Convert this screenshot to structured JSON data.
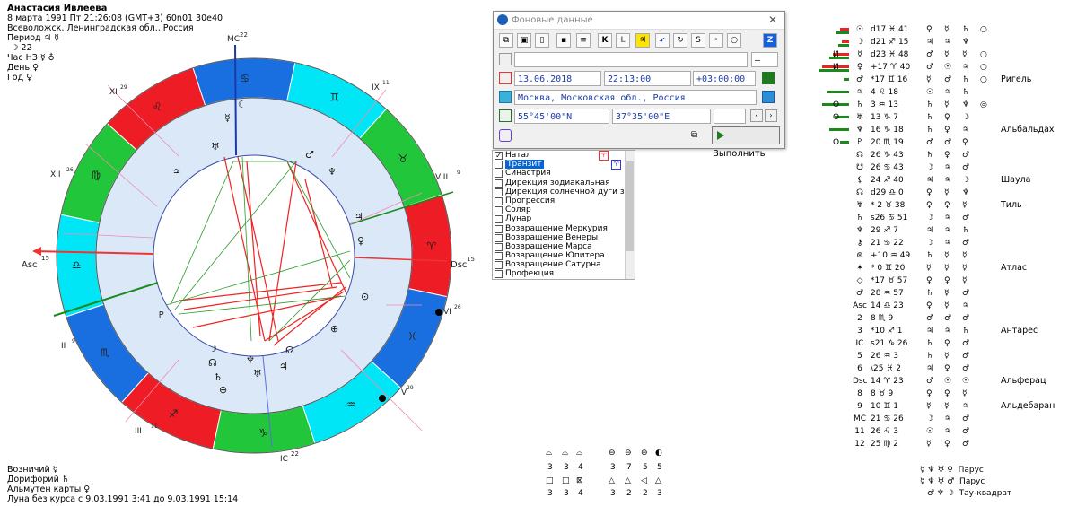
{
  "info": {
    "name": "Анастасия Ивлеева",
    "datetime": "8 марта 1991  Пт  21:26:08 (GMT+3) 60n01  30e40",
    "place": "Всеволожск, Ленинградская обл., Россия",
    "period": "Период ♃ ☿",
    "line_moon": "☽ 22",
    "hour_hz": "Час НЗ ☿ ♁",
    "day": "День ♀",
    "year": "Год ♀"
  },
  "bottom": {
    "voznichiy": "Возничий ☿",
    "doriforiy": "Дорифорий ♄",
    "almuten": "Альмутен карты ♀",
    "moon_void": "Луна без курса с 9.03.1991  3:41 до 9.03.1991 15:14"
  },
  "wheel": {
    "asc": "Asc",
    "asc_deg": "15",
    "dsc": "Dsc",
    "dsc_deg": "15",
    "mc": "MC",
    "mc_deg": "22",
    "ic": "IC",
    "ic_deg": "22",
    "houses": [
      "XII",
      "XI",
      "IX",
      "VIII",
      "VI",
      "V",
      "III",
      "II"
    ],
    "house_degs": [
      "26",
      "29",
      "11",
      "9",
      "26",
      "29",
      "11",
      "9"
    ],
    "signs": [
      "♈",
      "♉",
      "♊",
      "♋",
      "♌",
      "♍",
      "♎",
      "♏",
      "♐",
      "♑",
      "♒",
      "♓"
    ],
    "colors": {
      "fire": "#ee1c24",
      "earth": "#22c63b",
      "air": "#00e6f6",
      "water": "#1a6fe0",
      "inner": "#dbe8f7"
    }
  },
  "dialog": {
    "title": "Фоновые данные",
    "date": "13.06.2018",
    "time": "22:13:00",
    "tz": "+03:00:00",
    "city": "Москва, Московская обл., Россия",
    "lat": "55°45'00\"N",
    "lon": "37°35'00\"E",
    "run": "Выполнить",
    "sign_select": "–",
    "toolbar": [
      "K",
      "L",
      "Z"
    ]
  },
  "chartlist": [
    {
      "label": "Натал",
      "checked": true
    },
    {
      "label": "Транзит",
      "checked": false,
      "selected": true
    },
    {
      "label": "Синастрия",
      "checked": false
    },
    {
      "label": "Дирекция зодиакальная",
      "checked": false
    },
    {
      "label": "Дирекция солнечной дуги зодиак",
      "checked": false
    },
    {
      "label": "Прогрессия",
      "checked": false
    },
    {
      "label": "Соляр",
      "checked": false
    },
    {
      "label": "Лунар",
      "checked": false
    },
    {
      "label": "Возвращение Меркурия",
      "checked": false
    },
    {
      "label": "Возвращение Венеры",
      "checked": false
    },
    {
      "label": "Возвращение Марса",
      "checked": false
    },
    {
      "label": "Возвращение Юпитера",
      "checked": false
    },
    {
      "label": "Возвращение Сатурна",
      "checked": false
    },
    {
      "label": "Профекция",
      "checked": false
    }
  ],
  "planets": [
    {
      "sym": "☉",
      "pos": "d17 ♓ 41",
      "c1": "♀",
      "c2": "☿",
      "c3": "♄",
      "c4": "○",
      "bar": "red"
    },
    {
      "sym": "☽",
      "pos": "d21 ♐ 15",
      "c1": "♃",
      "c2": "♃",
      "c3": "♆",
      "c4": "",
      "bar": "red"
    },
    {
      "sym": "☿",
      "pos": "d23 ♓ 48",
      "c1": "♂",
      "c2": "☿",
      "c3": "☿",
      "c4": "○",
      "bar": "red",
      "mark": "И"
    },
    {
      "sym": "♀",
      "pos": "+17 ♈ 40",
      "c1": "♂",
      "c2": "☉",
      "c3": "♃",
      "c4": "○",
      "bar": "red",
      "mark": "И"
    },
    {
      "sym": "♂",
      "pos": "*17 ♊ 16",
      "c1": "☿",
      "c2": "♂",
      "c3": "♄",
      "c4": "○",
      "bar": "green"
    },
    {
      "sym": "♃",
      "pos": "4 ♌ 18",
      "c1": "☉",
      "c2": "♃",
      "c3": "♄",
      "c4": "",
      "bar": "green"
    },
    {
      "sym": "♄",
      "pos": "3 ♒ 13",
      "c1": "♄",
      "c2": "☿",
      "c3": "♆",
      "c4": "◎",
      "bar": "green",
      "mark": "О"
    },
    {
      "sym": "♅",
      "pos": "13 ♑ 7",
      "c1": "♄",
      "c2": "♀",
      "c3": "☽",
      "c4": "",
      "bar": "green",
      "mark": "О"
    },
    {
      "sym": "♆",
      "pos": "16 ♑ 18",
      "c1": "♄",
      "c2": "♀",
      "c3": "♃",
      "c4": "",
      "bar": "green"
    },
    {
      "sym": "♇",
      "pos": "20 ♏ 19",
      "c1": "♂",
      "c2": "♂",
      "c3": "♀",
      "c4": "",
      "bar": "green",
      "mark": "О"
    },
    {
      "sym": "☊",
      "pos": "26 ♑ 43",
      "c1": "♄",
      "c2": "♀",
      "c3": "♂",
      "c4": ""
    },
    {
      "sym": "☋",
      "pos": "26 ♋ 43",
      "c1": "☽",
      "c2": "♃",
      "c3": "♂",
      "c4": ""
    },
    {
      "sym": "⚸",
      "pos": "24 ♐ 40",
      "c1": "♃",
      "c2": "♃",
      "c3": "☽",
      "c4": ""
    },
    {
      "sym": "☊",
      "pos": "d29 ♎ 0",
      "c1": "♀",
      "c2": "☿",
      "c3": "♆",
      "c4": ""
    },
    {
      "sym": "♅",
      "pos": "* 2 ♉ 38",
      "c1": "♀",
      "c2": "♀",
      "c3": "☿",
      "c4": ""
    },
    {
      "sym": "♄",
      "pos": "s26 ♋ 51",
      "c1": "☽",
      "c2": "♃",
      "c3": "♂",
      "c4": ""
    },
    {
      "sym": "♆",
      "pos": "29 ♐ 7",
      "c1": "♃",
      "c2": "♃",
      "c3": "♄",
      "c4": ""
    },
    {
      "sym": "⚷",
      "pos": "21 ♋ 22",
      "c1": "☽",
      "c2": "♃",
      "c3": "♂",
      "c4": ""
    },
    {
      "sym": "⊛",
      "pos": "+10 ♒ 49",
      "c1": "♄",
      "c2": "☿",
      "c3": "☿",
      "c4": ""
    },
    {
      "sym": "✶",
      "pos": "* 0 ♊ 20",
      "c1": "☿",
      "c2": "☿",
      "c3": "☿",
      "c4": ""
    },
    {
      "sym": "◇",
      "pos": "*17 ♉ 57",
      "c1": "♀",
      "c2": "♀",
      "c3": "☿",
      "c4": ""
    },
    {
      "sym": "♂",
      "pos": "28 ♒ 57",
      "c1": "♄",
      "c2": "☿",
      "c3": "♂",
      "c4": ""
    },
    {
      "sym": "Asc",
      "pos": "14 ♎ 23",
      "c1": "♀",
      "c2": "☿",
      "c3": "♃",
      "c4": ""
    },
    {
      "sym": "2",
      "pos": "8 ♏ 9",
      "c1": "♂",
      "c2": "♂",
      "c3": "♂",
      "c4": ""
    },
    {
      "sym": "3",
      "pos": "*10 ♐ 1",
      "c1": "♃",
      "c2": "♃",
      "c3": "♄",
      "c4": ""
    },
    {
      "sym": "IC",
      "pos": "s21 ♑ 26",
      "c1": "♄",
      "c2": "♀",
      "c3": "♂",
      "c4": ""
    },
    {
      "sym": "5",
      "pos": "26 ♒ 3",
      "c1": "♄",
      "c2": "☿",
      "c3": "♂",
      "c4": ""
    },
    {
      "sym": "6",
      "pos": "\\25 ♓ 2",
      "c1": "♃",
      "c2": "♀",
      "c3": "♂",
      "c4": ""
    },
    {
      "sym": "Dsc",
      "pos": "14 ♈ 23",
      "c1": "♂",
      "c2": "☉",
      "c3": "☉",
      "c4": ""
    },
    {
      "sym": "8",
      "pos": "8 ♉ 9",
      "c1": "♀",
      "c2": "♀",
      "c3": "☿",
      "c4": ""
    },
    {
      "sym": "9",
      "pos": "10 ♊ 1",
      "c1": "☿",
      "c2": "☿",
      "c3": "♃",
      "c4": ""
    },
    {
      "sym": "MC",
      "pos": "21 ♋ 26",
      "c1": "☽",
      "c2": "♃",
      "c3": "♂",
      "c4": ""
    },
    {
      "sym": "11",
      "pos": "26 ♌ 3",
      "c1": "☉",
      "c2": "♃",
      "c3": "♂",
      "c4": ""
    },
    {
      "sym": "12",
      "pos": "25 ♍ 2",
      "c1": "☿",
      "c2": "♀",
      "c3": "♂",
      "c4": ""
    }
  ],
  "stars": [
    {
      "label": "Ригель",
      "row": 4
    },
    {
      "label": "Альбальдах",
      "row": 8
    },
    {
      "label": "Шаула",
      "row": 12
    },
    {
      "label": "Тиль",
      "row": 14
    },
    {
      "label": "Атлас",
      "row": 19
    },
    {
      "label": "Антарес",
      "row": 24
    },
    {
      "label": "Альферац",
      "row": 28
    },
    {
      "label": "Альдебаран",
      "row": 30
    }
  ],
  "aspect_grid": {
    "row1": [
      "3",
      "3",
      "4",
      "3",
      "7",
      "5",
      "5"
    ],
    "row2": [
      "3",
      "3",
      "4",
      "3",
      "2",
      "2",
      "3"
    ]
  },
  "figures": [
    {
      "syms": "☿ ♆ ♅ ♀",
      "label": "Парус"
    },
    {
      "syms": "☿ ♆ ♅ ♂",
      "label": "Парус"
    },
    {
      "syms": "♂ ♆ ☽",
      "label": "Тау-квадрат"
    }
  ]
}
